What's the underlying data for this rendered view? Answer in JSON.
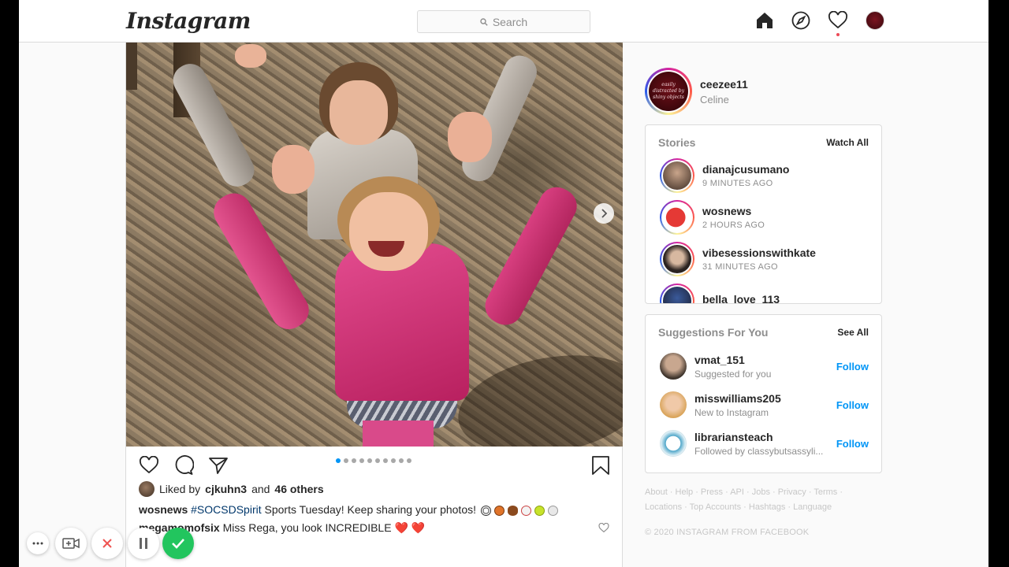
{
  "header": {
    "logo": "Instagram",
    "search_placeholder": "Search"
  },
  "post": {
    "likes_prefix": "Liked by",
    "liked_by": "cjkuhn3",
    "likes_and": "and",
    "likes_others": "46 others",
    "carousel": {
      "count": 10,
      "active": 0
    },
    "caption": {
      "user": "wosnews",
      "hashtag": "#SOCSDSpirit",
      "text": "Sports Tuesday! Keep sharing your photos!"
    },
    "comment": {
      "user": "megamomofsix",
      "text": "Miss Rega, you look INCREDIBLE ❤️ ❤️"
    }
  },
  "profile": {
    "username": "ceezee11",
    "fullname": "Celine",
    "avatar_text": "easily distracted by shiny objects"
  },
  "stories": {
    "title": "Stories",
    "action": "Watch All",
    "items": [
      {
        "name": "dianajcusumano",
        "time": "9 MINUTES AGO"
      },
      {
        "name": "wosnews",
        "time": "2 HOURS AGO"
      },
      {
        "name": "vibesessionswithkate",
        "time": "31 MINUTES AGO"
      },
      {
        "name": "bella_love_113",
        "time": ""
      }
    ]
  },
  "suggestions": {
    "title": "Suggestions For You",
    "action": "See All",
    "items": [
      {
        "name": "vmat_151",
        "sub": "Suggested for you",
        "action": "Follow"
      },
      {
        "name": "misswilliams205",
        "sub": "New to Instagram",
        "action": "Follow"
      },
      {
        "name": "librariansteach",
        "sub": "Followed by classybutsassyli...",
        "action": "Follow"
      }
    ]
  },
  "footer": {
    "links_line1": "About · Help · Press · API · Jobs · Privacy · Terms ·",
    "links_line2": "Locations · Top Accounts · Hashtags · Language",
    "copyright": "© 2020 INSTAGRAM FROM FACEBOOK"
  },
  "colors": {
    "link": "#0095f6",
    "hashtag": "#00376b",
    "record": "#22c55e",
    "cancel": "#ef5350"
  }
}
